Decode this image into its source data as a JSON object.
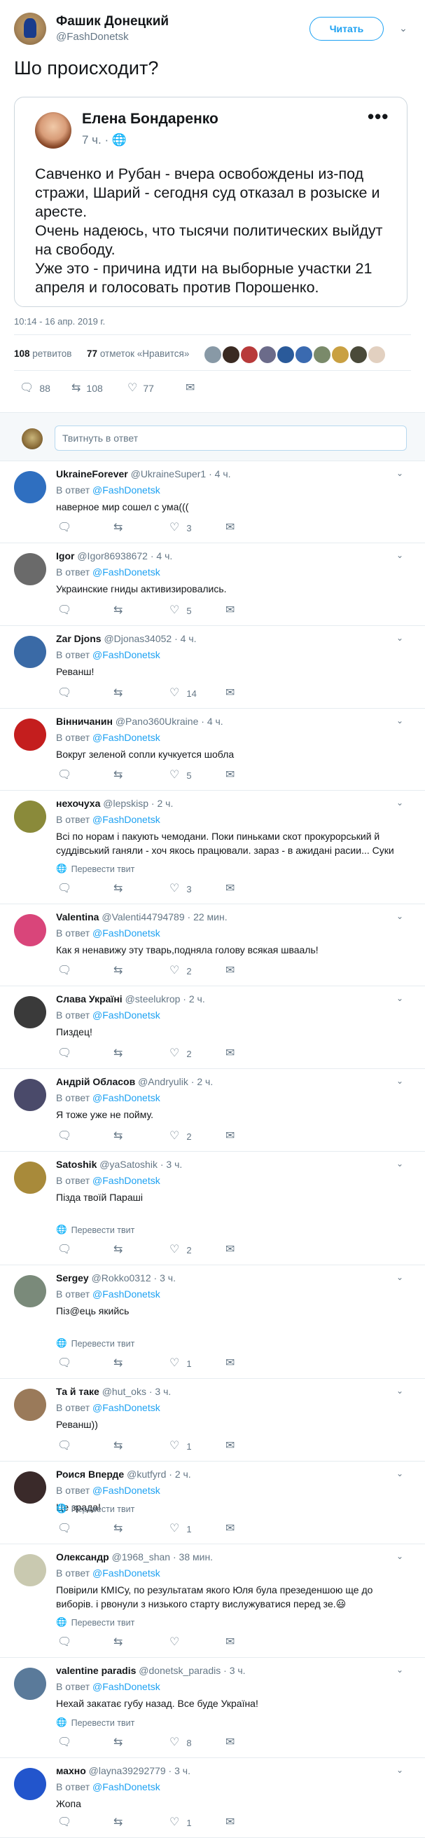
{
  "tweet": {
    "author_name": "Фашик Донецкий",
    "author_handle": "@FashDonetsk",
    "follow_label": "Читать",
    "text": "Шо происходит?",
    "timestamp": "10:14 - 16 апр. 2019 г.",
    "retweets_count": "108",
    "retweets_label": "ретвитов",
    "likes_count": "77",
    "likes_label": "отметок «Нравится»",
    "actions": {
      "replies": "88",
      "retweets": "108",
      "likes": "77"
    }
  },
  "quoted": {
    "author_name": "Елена Бондаренко",
    "time": "7 ч.",
    "text": "Савченко и Рубан - вчера освобождены из-под стражи, Шарий - сегодня суд отказал в розыске и аресте.\nОчень надеюсь, что тысячи политических выйдут на свободу.\nУже это - причина идти на выборные участки 21 апреля и голосовать против Порошенко."
  },
  "reply_box": {
    "placeholder": "Твитнуть в ответ"
  },
  "reply_to_label": "В ответ",
  "reply_to_handle": "@FashDonetsk",
  "translate_label": "Перевести твит",
  "replies": [
    {
      "name": "UkraineForever",
      "handle": "@UkraineSuper1",
      "time": "4 ч.",
      "text": "наверное мир сошел с ума(((",
      "translate": false,
      "likes": "3"
    },
    {
      "name": "Igor",
      "handle": "@Igor86938672",
      "time": "4 ч.",
      "text": "Украинские гниды активизировались.",
      "translate": false,
      "likes": "5"
    },
    {
      "name": "Zar Djons",
      "handle": "@Djonas34052",
      "time": "4 ч.",
      "text": "Реванш!",
      "translate": false,
      "likes": "14"
    },
    {
      "name": "Вінничанин",
      "handle": "@Pano360Ukraine",
      "time": "4 ч.",
      "text": "Вокруг зеленой сопли кучкуется шобла",
      "translate": false,
      "likes": "5"
    },
    {
      "name": "нехочуха",
      "handle": "@lepskisp",
      "time": "2 ч.",
      "text": "Всі по норам і пакують чемодани. Поки пиньками скот прокурорський й суддівський ганяли - хоч якось працювали. зараз - в ажидані расии... Суки",
      "translate": true,
      "likes": "3"
    },
    {
      "name": "Valentina",
      "handle": "@Valenti44794789",
      "time": "22 мин.",
      "text": "Как я ненавижу эту тварь,подняла голову всякая швааль!",
      "translate": false,
      "likes": "2"
    },
    {
      "name": "Слава Україні",
      "handle": "@steelukrop",
      "time": "2 ч.",
      "text": "Пиздец!",
      "translate": false,
      "likes": "2"
    },
    {
      "name": "Андрій Обласов",
      "handle": "@Andryulik",
      "time": "2 ч.",
      "text": "Я тоже уже не пойму.",
      "translate": false,
      "likes": "2"
    },
    {
      "name": "Satoshik",
      "handle": "@yaSatoshik",
      "time": "3 ч.",
      "text": "Пізда твоїй Параші",
      "translate": true,
      "likes": "2"
    },
    {
      "name": "Sergey",
      "handle": "@Rokko0312",
      "time": "3 ч.",
      "text": "Піз@ець якийсь",
      "translate": true,
      "likes": "1"
    },
    {
      "name": "Та й таке",
      "handle": "@hut_oks",
      "time": "3 ч.",
      "text": "Реванш))",
      "translate": false,
      "likes": "1"
    },
    {
      "name": "Роися Вперде",
      "handle": "@kutfyrd",
      "time": "2 ч.",
      "text": "Це зрада!",
      "translate": true,
      "likes": "1"
    },
    {
      "name": "Олександр",
      "handle": "@1968_shan",
      "time": "38 мин.",
      "text": "Повірили КМІСу, по результатам якого Юля була презеденшою ще до виборів. і рвонули з низького старту вислужуватися перед зе.😃",
      "translate": true,
      "likes": ""
    },
    {
      "name": "valentine paradis",
      "handle": "@donetsk_paradis",
      "time": "3 ч.",
      "text": "Нехай закатає губу назад. Все буде Україна!",
      "translate": true,
      "likes": "8"
    },
    {
      "name": "махно",
      "handle": "@layna39292779",
      "time": "3 ч.",
      "text": "Жопа",
      "translate": false,
      "likes": "1"
    }
  ],
  "colors": {
    "accent": "#1da1f2",
    "muted": "#657786",
    "text": "#14171a",
    "border": "#e6ecf0"
  },
  "icons": [
    "chevron-down-icon",
    "more-icon",
    "globe-icon",
    "reply-icon",
    "retweet-icon",
    "like-icon",
    "message-icon",
    "translate-icon"
  ]
}
